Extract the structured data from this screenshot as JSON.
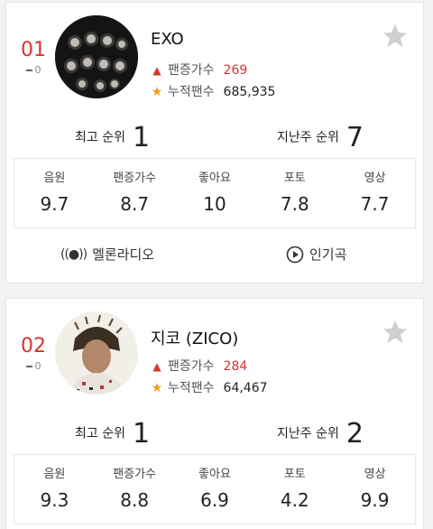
{
  "artists": [
    {
      "rank": "01",
      "rank_change": "0",
      "name": "EXO",
      "fan_increase_label": "팬증가수",
      "fan_increase_value": "269",
      "total_fans_label": "누적팬수",
      "total_fans_value": "685,935",
      "peak_rank_label": "최고 순위",
      "peak_rank_value": "1",
      "last_week_label": "지난주 순위",
      "last_week_value": "7",
      "scores": [
        {
          "label": "음원",
          "value": "9.7"
        },
        {
          "label": "팬증가수",
          "value": "8.7"
        },
        {
          "label": "좋아요",
          "value": "10"
        },
        {
          "label": "포토",
          "value": "7.8"
        },
        {
          "label": "영상",
          "value": "7.7"
        }
      ],
      "actions": {
        "radio_label": "멜론라디오",
        "popular_label": "인기곡"
      }
    },
    {
      "rank": "02",
      "rank_change": "0",
      "name": "지코 (ZICO)",
      "fan_increase_label": "팬증가수",
      "fan_increase_value": "284",
      "total_fans_label": "누적팬수",
      "total_fans_value": "64,467",
      "peak_rank_label": "최고 순위",
      "peak_rank_value": "1",
      "last_week_label": "지난주 순위",
      "last_week_value": "2",
      "scores": [
        {
          "label": "음원",
          "value": "9.3"
        },
        {
          "label": "팬증가수",
          "value": "8.8"
        },
        {
          "label": "좋아요",
          "value": "6.9"
        },
        {
          "label": "포토",
          "value": "4.2"
        },
        {
          "label": "영상",
          "value": "9.9"
        }
      ]
    }
  ],
  "icons": {
    "favorite": "star-outline-icon",
    "fan_increase": "arrow-up-icon",
    "total_fans": "star-icon",
    "radio": "radio-broadcast-icon",
    "play": "play-circle-icon"
  },
  "colors": {
    "rank": "#d63232",
    "fan_increase": "#d63232",
    "star": "#f29a1d",
    "favorite_star": "#cfcfcf"
  }
}
